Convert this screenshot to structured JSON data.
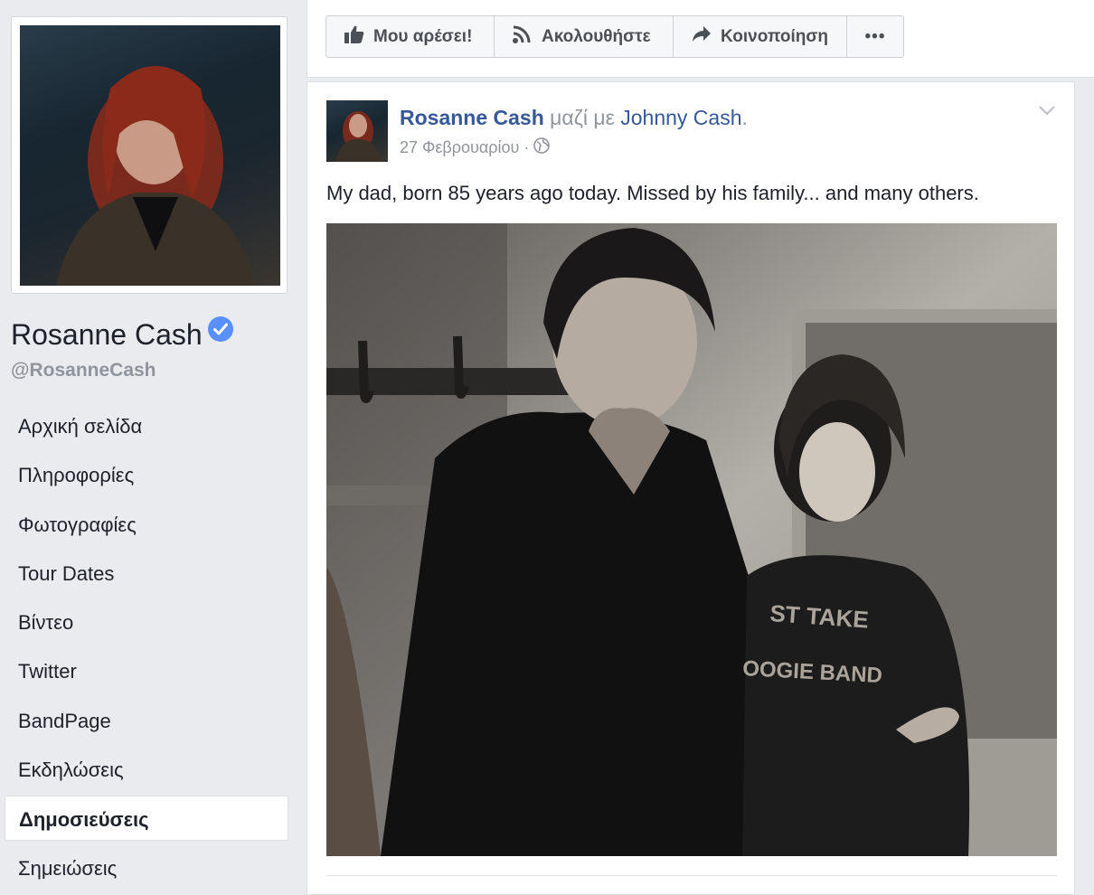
{
  "page": {
    "name": "Rosanne Cash",
    "handle": "@RosanneCash"
  },
  "nav": {
    "items": [
      {
        "label": "Αρχική σελίδα"
      },
      {
        "label": "Πληροφορίες"
      },
      {
        "label": "Φωτογραφίες"
      },
      {
        "label": "Tour Dates"
      },
      {
        "label": "Βίντεο"
      },
      {
        "label": "Twitter"
      },
      {
        "label": "BandPage"
      },
      {
        "label": "Εκδηλώσεις"
      },
      {
        "label": "Δημοσιεύσεις",
        "active": true
      },
      {
        "label": "Σημειώσεις"
      }
    ]
  },
  "actions": {
    "like": "Μου αρέσει!",
    "follow": "Ακολουθήστε",
    "share": "Κοινοποίηση",
    "more": "•••"
  },
  "post": {
    "author": "Rosanne Cash",
    "with_text": "μαζί με",
    "tagged": "Johnny Cash",
    "period": ".",
    "date": "27 Φεβρουαρίου",
    "separator": "·",
    "text": "My dad, born 85 years ago today. Missed by his family... and many others.",
    "photo_shirt_text": [
      "ST TAKE",
      "OOGIE BAND"
    ]
  },
  "colors": {
    "background": "#e9ebee",
    "link": "#365899",
    "verified": "#5890ff",
    "muted": "#90949c"
  },
  "icons": {
    "like": "thumbs-up-icon",
    "follow": "rss-icon",
    "share": "share-arrow-icon",
    "verified": "verified-check-icon",
    "audience": "globe-icon",
    "menu": "chevron-down-icon"
  }
}
